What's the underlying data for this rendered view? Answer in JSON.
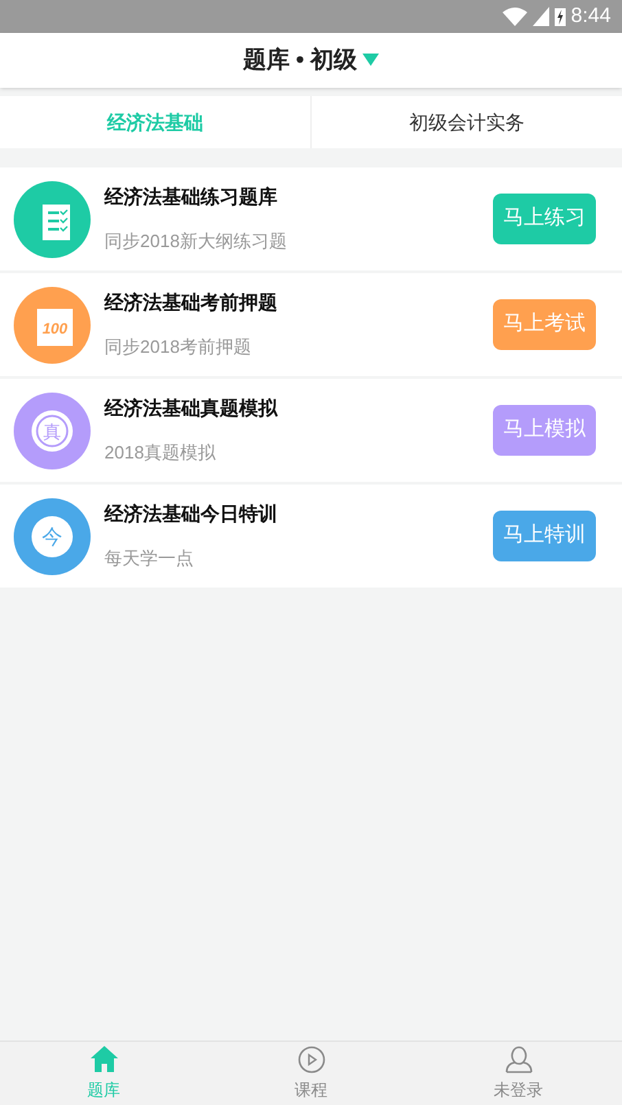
{
  "status_bar": {
    "time": "8:44"
  },
  "header": {
    "title": "题库 • 初级"
  },
  "tabs": [
    {
      "label": "经济法基础",
      "selected": true
    },
    {
      "label": "初级会计实务",
      "selected": false
    }
  ],
  "items": [
    {
      "kind": "notebook",
      "color": "#1ecba5",
      "title": "经济法基础练习题库",
      "subtitle": "同步2018新大纲练习题",
      "button": "马上练习"
    },
    {
      "kind": "score",
      "color": "#ffa04f",
      "icon_text": "100",
      "title": "经济法基础考前押题",
      "subtitle": "同步2018考前押题",
      "button": "马上考试"
    },
    {
      "kind": "stamp",
      "color": "#b49cfb",
      "icon_text": "真",
      "title": "经济法基础真题模拟",
      "subtitle": "2018真题模拟",
      "button": "马上模拟"
    },
    {
      "kind": "badge",
      "color": "#4aa8e8",
      "icon_text": "今",
      "title": "经济法基础今日特训",
      "subtitle": "每天学一点",
      "button": "马上特训"
    }
  ],
  "bottom_nav": [
    {
      "kind": "home",
      "label": "题库",
      "selected": true
    },
    {
      "kind": "play",
      "label": "课程",
      "selected": false
    },
    {
      "kind": "user",
      "label": "未登录",
      "selected": false
    }
  ]
}
